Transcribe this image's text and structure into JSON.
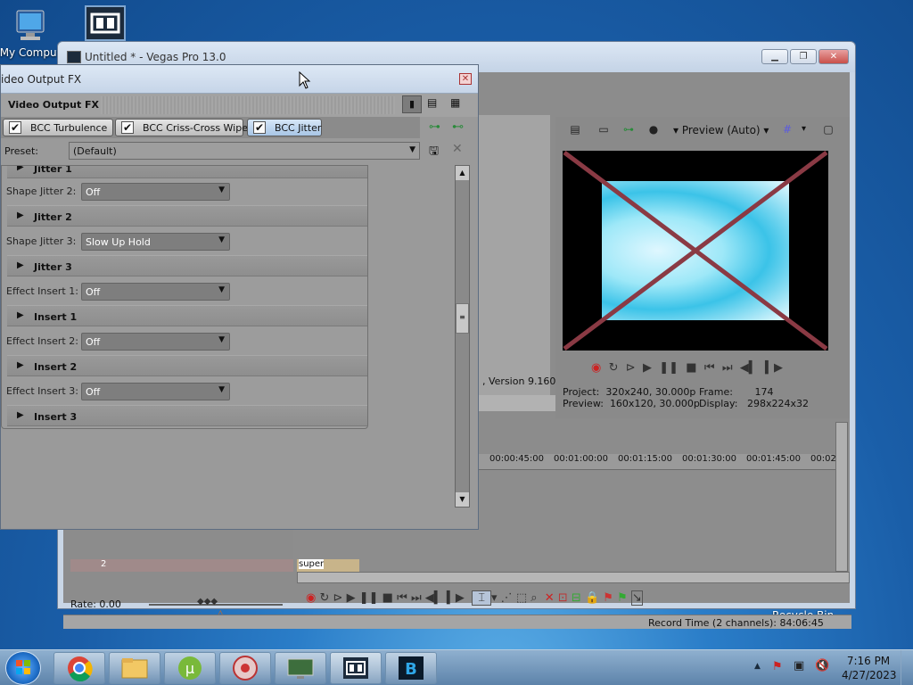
{
  "desktop": {
    "my_computer": "My Comput",
    "recycle_bin": "Recycle Bin"
  },
  "vegas": {
    "title": "Untitled * - Vegas Pro 13.0",
    "version_text": ", Version 9.160",
    "preview_label": "Preview (Auto)",
    "project_label": "Project:",
    "project_value": "320x240, 30.000p",
    "preview_info_label": "Preview:",
    "preview_info_value": "160x120, 30.000p",
    "frame_label": "Frame:",
    "frame_value": "174",
    "display_label": "Display:",
    "display_value": "298x224x32",
    "ruler": [
      "00:00:45:00",
      "00:01:00:00",
      "00:01:15:00",
      "00:01:30:00",
      "00:01:45:00",
      "00:02"
    ],
    "rate_label": "Rate: 0.00",
    "record_time": "Record Time (2 channels): 84:06:45",
    "track_text": "super",
    "track_num": "2"
  },
  "fx": {
    "title": "ideo Output FX",
    "header": "Video Output FX",
    "chain": [
      "BCC Turbulence",
      "BCC Criss-Cross Wipe",
      "BCC Jitter"
    ],
    "preset_label": "Preset:",
    "preset_value": "(Default)",
    "rows": [
      {
        "type": "group",
        "label": "Jitter 1"
      },
      {
        "type": "field",
        "label": "Shape Jitter 2:",
        "value": "Off"
      },
      {
        "type": "group",
        "label": "Jitter 2"
      },
      {
        "type": "field",
        "label": "Shape Jitter 3:",
        "value": "Slow Up Hold"
      },
      {
        "type": "group",
        "label": "Jitter 3"
      },
      {
        "type": "field",
        "label": "Effect Insert 1:",
        "value": "Off"
      },
      {
        "type": "group",
        "label": "Insert 1"
      },
      {
        "type": "field",
        "label": "Effect Insert 2:",
        "value": "Off"
      },
      {
        "type": "group",
        "label": "Insert 2"
      },
      {
        "type": "field",
        "label": "Effect Insert 3:",
        "value": "Off"
      },
      {
        "type": "group",
        "label": "Insert 3"
      }
    ]
  },
  "clock": {
    "time": "7:16 PM",
    "date": "4/27/2023"
  },
  "colors": {
    "accent": "#8a3a44",
    "chip_selected": "#b9d3ef"
  }
}
